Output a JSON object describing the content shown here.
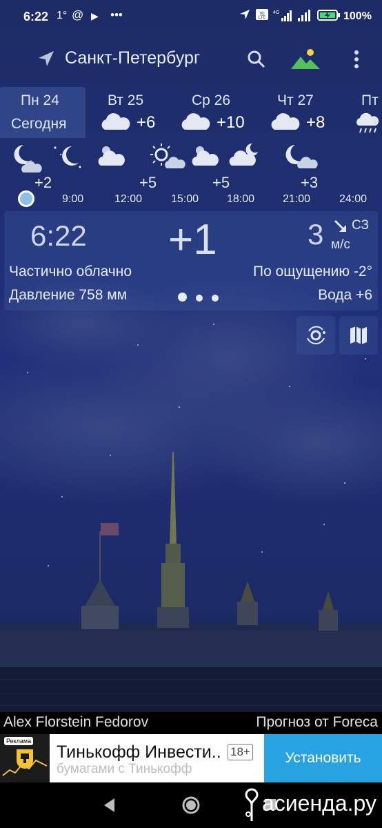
{
  "status_bar": {
    "time": "6:22",
    "temp": "1°",
    "battery": "100%"
  },
  "toolbar": {
    "city": "Санкт-Петербург"
  },
  "days": [
    {
      "name": "Пн 24",
      "sub": "Сегодня",
      "temp": "",
      "selected": true
    },
    {
      "name": "Вт 25",
      "sub": "",
      "temp": "+6",
      "icon": "cloud-icon"
    },
    {
      "name": "Ср 26",
      "sub": "",
      "temp": "+10",
      "icon": "cloud-icon"
    },
    {
      "name": "Чт 27",
      "sub": "",
      "temp": "+8",
      "icon": "cloud-icon"
    },
    {
      "name": "Пт",
      "sub": "",
      "temp": "",
      "icon": "rain-cloud-icon"
    }
  ],
  "hourly": {
    "temps": [
      "+2",
      "+5",
      "+5",
      "+3"
    ],
    "times": [
      "9:00",
      "12:00",
      "15:00",
      "18:00",
      "21:00",
      "24:00"
    ]
  },
  "current": {
    "time": "6:22",
    "temp": "+1",
    "wind_speed": "3",
    "wind_dir": "СЗ",
    "wind_unit": "м/с",
    "description": "Частично облачно",
    "feels_like": "По ощущению -2°",
    "pressure": "Давление 758 мм",
    "water": "Вода +6"
  },
  "credits": {
    "photo": "Alex Florstein Fedorov",
    "forecast": "Прогноз от Foreca"
  },
  "ad": {
    "badge": "Реклама",
    "title": "Тинькофф Инвести..",
    "age": "18+",
    "subtitle": "бумагами с Тинькофф",
    "install": "Установить"
  },
  "watermark": "асиенда.ру",
  "colors": {
    "sky": "#1a2a62",
    "accent": "#26a3e0",
    "mountain": "#55c05a",
    "sun": "#f5d244"
  }
}
